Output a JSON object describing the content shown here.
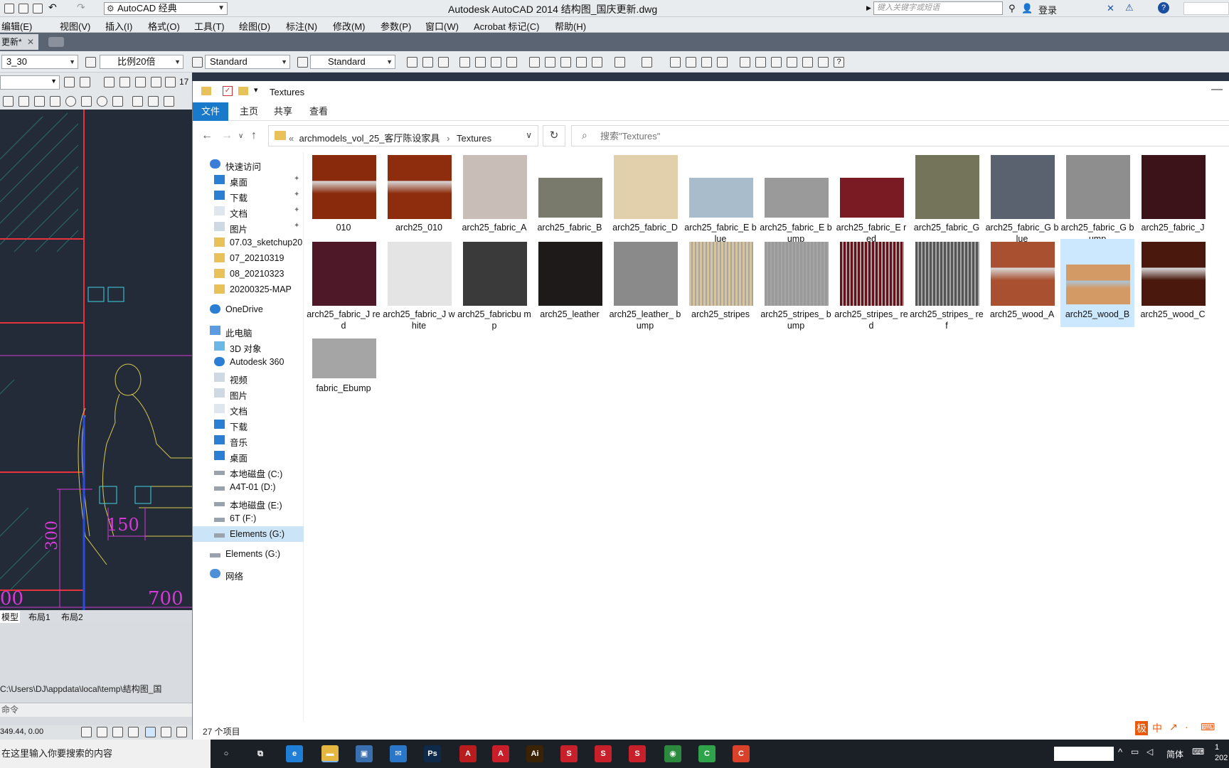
{
  "acad": {
    "workspace": "AutoCAD 经典",
    "title": "Autodesk AutoCAD 2014     结构图_国庆更新.dwg",
    "search_placeholder": "键入关键字或短语",
    "login": "登录",
    "menus": [
      "编辑(E)",
      "视图(V)",
      "插入(I)",
      "格式(O)",
      "工具(T)",
      "绘图(D)",
      "标注(N)",
      "修改(M)",
      "参数(P)",
      "窗口(W)",
      "Acrobat 标记(C)",
      "帮助(H)"
    ],
    "doc_tab": "更新*",
    "toolbar": {
      "combo1": "3_30",
      "combo2": "比例20倍",
      "combo3": "Standard",
      "combo4": "Standard"
    },
    "layer_count": "17",
    "dims": {
      "d150": "150",
      "d300": "300",
      "d700": "700",
      "d00": "00"
    },
    "layout_tabs": [
      "模型",
      "布局1",
      "布局2"
    ],
    "cmd_line": "C:\\Users\\DJ\\appdata\\local\\temp\\結构图_国",
    "cmd_prompt": "命令",
    "coords": "349.44, 0.00",
    "colors": {
      "canvas": "#222b37",
      "red": "#e8323a",
      "magenta": "#d43ad6",
      "cyan": "#3ed0e6",
      "yellow": "#d8c850"
    }
  },
  "explorer": {
    "title": "Textures",
    "ribbon_tabs": [
      "文件",
      "主页",
      "共享",
      "查看"
    ],
    "path": [
      "archmodels_vol_25_客厅陈设家具",
      "Textures"
    ],
    "search_placeholder": "搜索\"Textures\"",
    "nav": [
      {
        "label": "快速访问",
        "icon": "star-icon"
      },
      {
        "label": "桌面",
        "icon": "desktop-icon",
        "pinned": true
      },
      {
        "label": "下载",
        "icon": "download-icon",
        "pinned": true
      },
      {
        "label": "文档",
        "icon": "document-icon",
        "pinned": true
      },
      {
        "label": "图片",
        "icon": "picture-icon",
        "pinned": true
      },
      {
        "label": "07.03_sketchup20",
        "icon": "folder-icon"
      },
      {
        "label": "07_20210319",
        "icon": "folder-icon"
      },
      {
        "label": "08_20210323",
        "icon": "folder-icon"
      },
      {
        "label": "20200325-MAP",
        "icon": "folder-icon"
      },
      {
        "label": "OneDrive",
        "icon": "cloud-icon"
      },
      {
        "label": "此电脑",
        "icon": "computer-icon"
      },
      {
        "label": "3D 对象",
        "icon": "cube-icon"
      },
      {
        "label": "Autodesk 360",
        "icon": "cloud-icon"
      },
      {
        "label": "视频",
        "icon": "video-icon"
      },
      {
        "label": "图片",
        "icon": "picture-icon"
      },
      {
        "label": "文档",
        "icon": "document-icon"
      },
      {
        "label": "下载",
        "icon": "download-icon"
      },
      {
        "label": "音乐",
        "icon": "music-icon"
      },
      {
        "label": "桌面",
        "icon": "desktop-icon"
      },
      {
        "label": "本地磁盘 (C:)",
        "icon": "drive-icon"
      },
      {
        "label": "A4T-01 (D:)",
        "icon": "drive-icon"
      },
      {
        "label": "本地磁盘 (E:)",
        "icon": "drive-icon"
      },
      {
        "label": "6T (F:)",
        "icon": "drive-icon"
      },
      {
        "label": "Elements (G:)",
        "icon": "drive-icon",
        "selected": true
      },
      {
        "label": "Elements (G:)",
        "icon": "drive-icon"
      },
      {
        "label": "网络",
        "icon": "network-icon"
      }
    ],
    "files": [
      {
        "name": "010",
        "thumb": "#8a2a0c"
      },
      {
        "name": "arch25_010",
        "thumb": "#8e2d0d"
      },
      {
        "name": "arch25_fabric_A",
        "thumb": "#c9bdb8"
      },
      {
        "name": "arch25_fabric_B",
        "thumb": "#7a7a6c"
      },
      {
        "name": "arch25_fabric_D",
        "thumb": "#e2d0ac"
      },
      {
        "name": "arch25_fabric_E blue",
        "thumb": "#a9bccb"
      },
      {
        "name": "arch25_fabric_E bump",
        "thumb": "#9a9a9a"
      },
      {
        "name": "arch25_fabric_E red",
        "thumb": "#7a1a22"
      },
      {
        "name": "arch25_fabric_G",
        "thumb": "#74745a"
      },
      {
        "name": "arch25_fabric_G blue",
        "thumb": "#5a6270"
      },
      {
        "name": "arch25_fabric_G bump",
        "thumb": "#8e8e8e"
      },
      {
        "name": "arch25_fabric_J",
        "thumb": "#3b1318"
      },
      {
        "name": "arch25_fabric_J red",
        "thumb": "#4e1828"
      },
      {
        "name": "arch25_fabric_J white",
        "thumb": "#e4e4e4"
      },
      {
        "name": "arch25_fabricbu mp",
        "thumb": "#3a3a3a"
      },
      {
        "name": "arch25_leather",
        "thumb": "#1e1a1a"
      },
      {
        "name": "arch25_leather_ bump",
        "thumb": "#8a8a8a"
      },
      {
        "name": "arch25_stripes",
        "thumb": "#d8c498"
      },
      {
        "name": "arch25_stripes_ bump",
        "thumb": "#9a9a9a"
      },
      {
        "name": "arch25_stripes_ red",
        "thumb": "#6a1018"
      },
      {
        "name": "arch25_stripes_ ref",
        "thumb": "#555555"
      },
      {
        "name": "arch25_wood_A",
        "thumb": "#a85030"
      },
      {
        "name": "arch25_wood_B",
        "thumb": "#d39a66",
        "selected": true
      },
      {
        "name": "arch25_wood_C",
        "thumb": "#4a180c"
      },
      {
        "name": "fabric_Ebump",
        "thumb": "#a5a5a5"
      }
    ],
    "item_count": "27 个项目"
  },
  "taskbar": {
    "search_placeholder": "在这里输入你要搜索的内容",
    "lang": "简体",
    "time": "1",
    "date": "202",
    "ime": [
      "极",
      "中",
      "↗",
      "·",
      "⌨"
    ],
    "apps": [
      {
        "name": "cortana-icon",
        "label": "○",
        "color": "#1b1f26"
      },
      {
        "name": "task-view-icon",
        "label": "⧉",
        "color": "#1b1f26"
      },
      {
        "name": "edge-icon",
        "label": "e",
        "color": "#1f7ed6"
      },
      {
        "name": "file-explorer-icon",
        "label": "▬",
        "color": "#e5b640"
      },
      {
        "name": "store-icon",
        "label": "▣",
        "color": "#3a6fb0"
      },
      {
        "name": "mail-icon",
        "label": "✉",
        "color": "#2a76c8"
      },
      {
        "name": "photoshop-icon",
        "label": "Ps",
        "color": "#0d2a4a"
      },
      {
        "name": "acrobat-icon",
        "label": "A",
        "color": "#b81c1c"
      },
      {
        "name": "autocad-icon",
        "label": "A",
        "color": "#c81e2a"
      },
      {
        "name": "illustrator-icon",
        "label": "Ai",
        "color": "#3a2205"
      },
      {
        "name": "sketchup-icon-1",
        "label": "S",
        "color": "#c8202a"
      },
      {
        "name": "sketchup-icon-2",
        "label": "S",
        "color": "#c8202a"
      },
      {
        "name": "sketchup-icon-3",
        "label": "S",
        "color": "#c8202a"
      },
      {
        "name": "chrome-icon",
        "label": "◉",
        "color": "#2b8a3e"
      },
      {
        "name": "camtasia-green-icon",
        "label": "C",
        "color": "#2fa34a"
      },
      {
        "name": "camtasia-red-icon",
        "label": "C",
        "color": "#d9412b"
      }
    ]
  }
}
